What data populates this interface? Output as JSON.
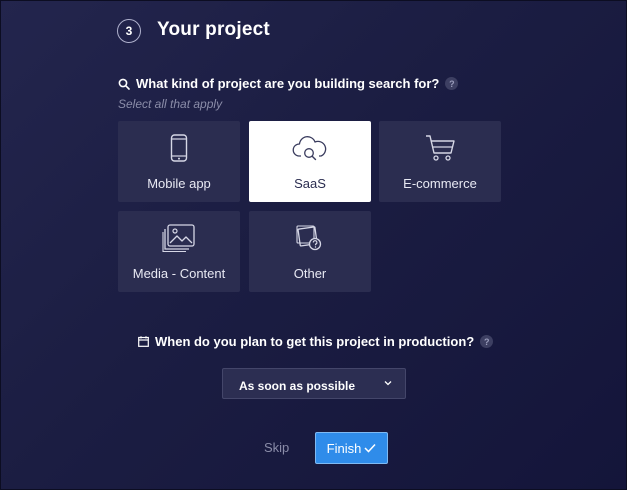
{
  "step": {
    "number": "3",
    "title": "Your project"
  },
  "project_question": {
    "text": "What kind of project are you building search for?",
    "help": "?",
    "hint": "Select all that apply"
  },
  "project_types": [
    {
      "label": "Mobile app",
      "icon": "mobile-phone-icon",
      "selected": false
    },
    {
      "label": "SaaS",
      "icon": "cloud-search-icon",
      "selected": true
    },
    {
      "label": "E-commerce",
      "icon": "shopping-cart-icon",
      "selected": false
    },
    {
      "label": "Media - Content",
      "icon": "image-gallery-icon",
      "selected": false
    },
    {
      "label": "Other",
      "icon": "question-card-icon",
      "selected": false
    }
  ],
  "timeline_question": {
    "text": "When do you plan to get this project in production?",
    "help": "?"
  },
  "timeline_select": {
    "value": "As soon as possible"
  },
  "actions": {
    "skip": "Skip",
    "finish": "Finish"
  },
  "colors": {
    "background": "#1b1d42",
    "card": "#2b2d50",
    "card_selected": "#ffffff",
    "accent": "#2f8cea",
    "muted_text": "#8a8ca8"
  }
}
